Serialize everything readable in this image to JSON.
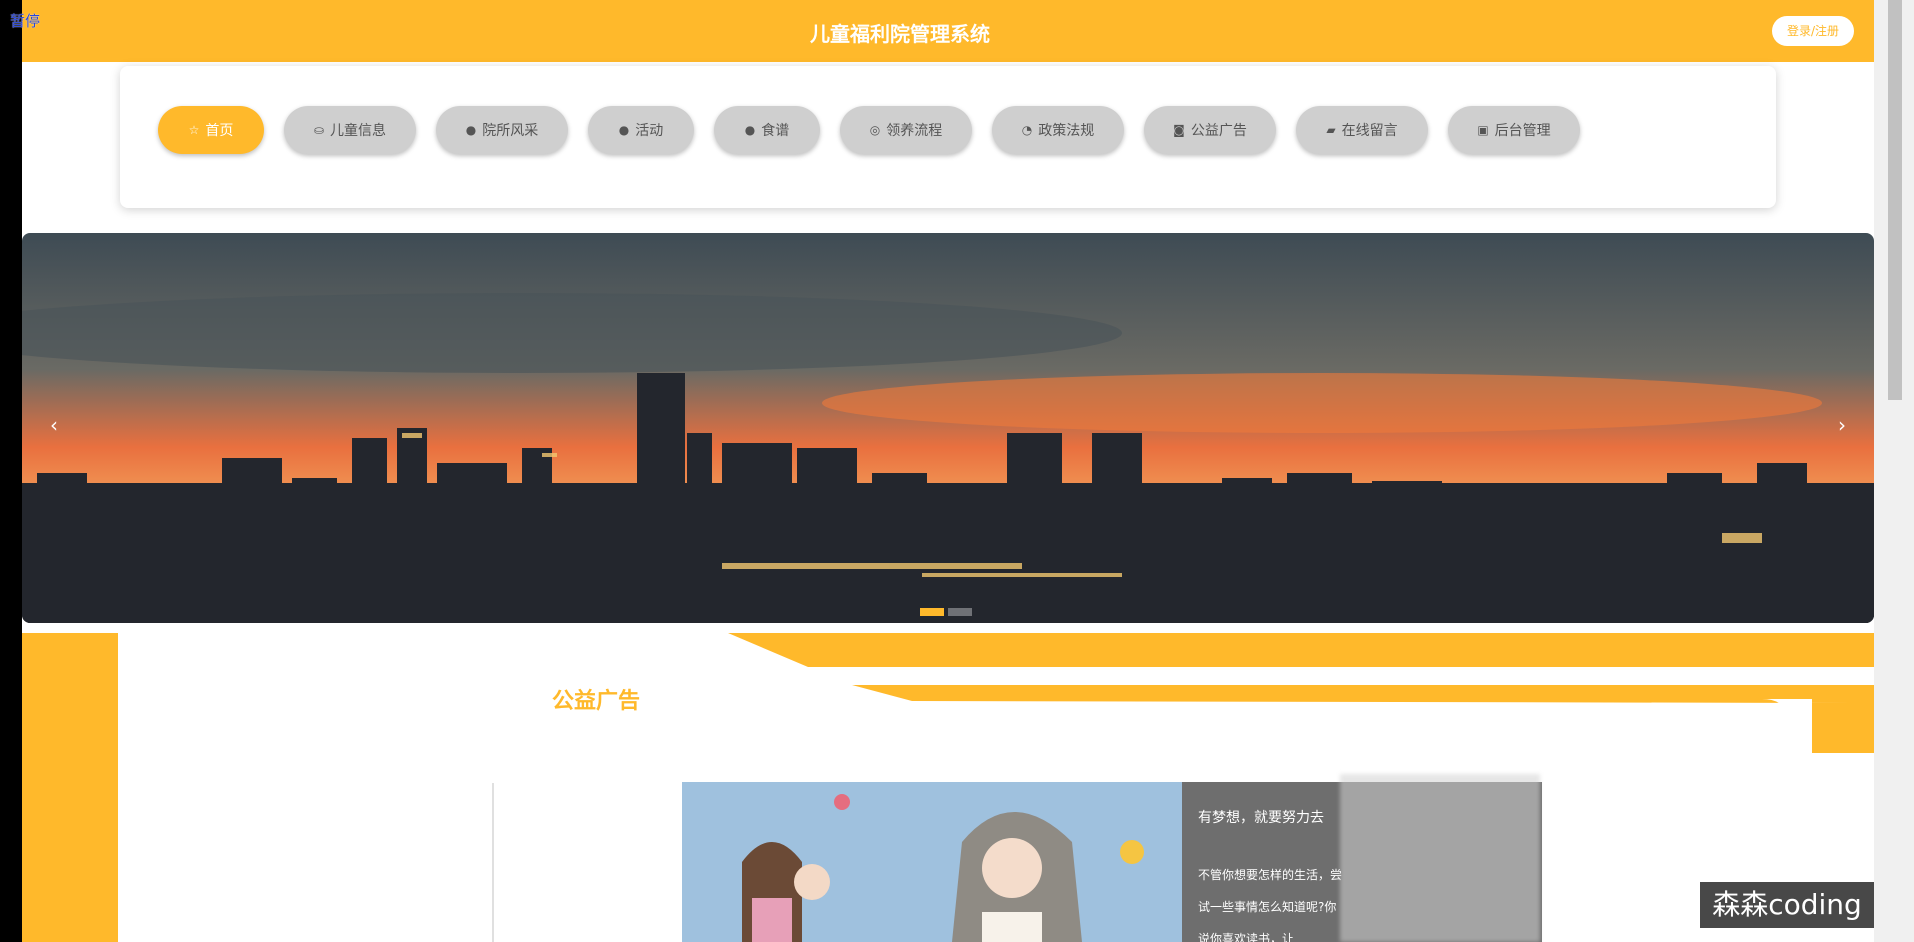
{
  "overlay": {
    "pause_label": "暂停"
  },
  "header": {
    "title": "儿童福利院管理系统",
    "login_label": "登录/注册"
  },
  "nav": {
    "items": [
      {
        "label": "首页",
        "icon": "star-icon",
        "active": true
      },
      {
        "label": "儿童信息",
        "icon": "bag-icon"
      },
      {
        "label": "院所风采",
        "icon": "exclamation-icon"
      },
      {
        "label": "活动",
        "icon": "question-icon"
      },
      {
        "label": "食谱",
        "icon": "info-icon"
      },
      {
        "label": "领养流程",
        "icon": "globe-icon"
      },
      {
        "label": "政策法规",
        "icon": "compass-icon"
      },
      {
        "label": "公益广告",
        "icon": "camera-icon"
      },
      {
        "label": "在线留言",
        "icon": "car-icon"
      },
      {
        "label": "后台管理",
        "icon": "briefcase-icon"
      }
    ]
  },
  "banner": {
    "prev": "‹",
    "next": "›"
  },
  "section": {
    "title": "公益广告",
    "ad_headline": "有梦想，就要努力去",
    "ad_desc": "不管你想要怎样的生活，尝试一些事情怎么知道呢?你说你喜欢读书，让"
  },
  "watermark": {
    "text": "森森coding"
  },
  "colors": {
    "accent": "#ffb92b"
  }
}
